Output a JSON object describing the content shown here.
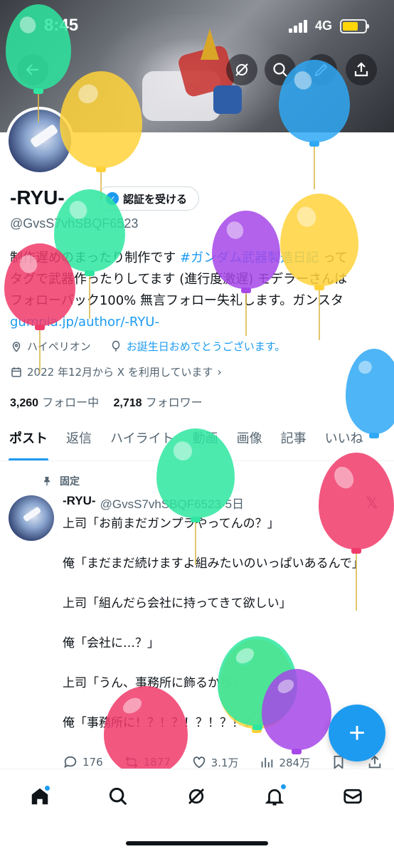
{
  "status_bar": {
    "time": "8:45",
    "network": "4G"
  },
  "profile": {
    "display_name": "-RYU-",
    "verify_button": "認証を受ける",
    "handle": "@GvsS7vhSBQF6523",
    "bio": {
      "line1_pre": "制作遅めのまったり制作です ",
      "hashtag": "#ガンダム武器製造日記",
      "line1_post": " って",
      "line2": "タグで武器作ったりしてます (進行度激遅) モデラーさんは",
      "line3": "フォローバック100% 無言フォロー失礼します。ガンスタ",
      "link": "gumpla.jp/author/-RYU-"
    },
    "location": "ハイペリオン",
    "birthday": "お誕生日おめでとうございます。",
    "joined": "2022 年12月から X を利用しています",
    "following_count": "3,260",
    "following_label": "フォロー中",
    "followers_count": "2,718",
    "followers_label": "フォロワー"
  },
  "tabs": [
    "ポスト",
    "返信",
    "ハイライト",
    "動画",
    "画像",
    "記事",
    "いいね"
  ],
  "pinned_tweet": {
    "pinned_label": "固定",
    "name": "-RYU-",
    "meta": "@GvsS7vhSBQF6523·5日",
    "lines": [
      "上司「お前まだガンプラやってんの？」",
      "俺「まだまだ続けますよ組みたいのいっぱいあるんで」",
      "上司「組んだら会社に持ってきて欲しい」",
      "俺「会社に…？」",
      "上司「うん、事務所に飾るから」",
      "俺「事務所に！？！？！？！？！？」"
    ],
    "replies": "176",
    "reposts": "1877",
    "likes": "3.1万",
    "views": "284万"
  },
  "colors": {
    "accent": "#1d9bf0",
    "balloon_green": "#2ee6a0",
    "balloon_yellow": "#ffd23a",
    "balloon_blue": "#2fa8f5",
    "balloon_purple": "#a647e8",
    "balloon_red": "#f03a6a"
  },
  "icons": {
    "banner": [
      "back-arrow-icon",
      "grok-icon",
      "search-icon",
      "edit-icon",
      "share-icon"
    ],
    "bottom_nav": [
      "home-icon",
      "search-icon",
      "grok-icon",
      "bell-icon",
      "mail-icon"
    ]
  }
}
